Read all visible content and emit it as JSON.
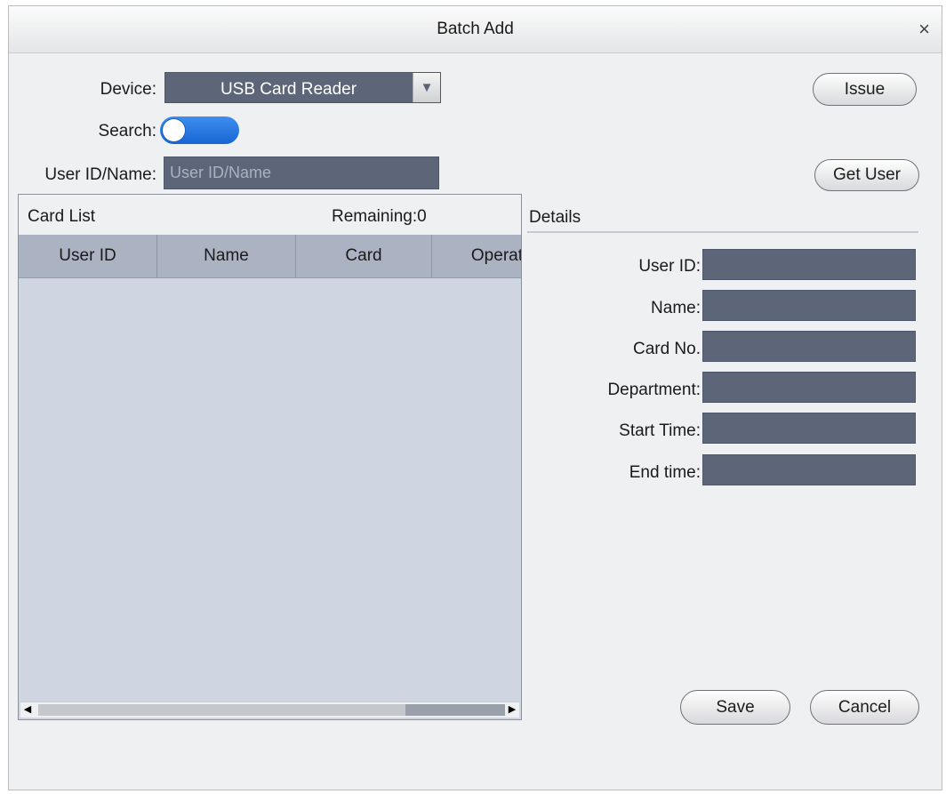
{
  "window": {
    "title": "Batch Add",
    "close_glyph": "×"
  },
  "device": {
    "label": "Device:",
    "value": "USB Card Reader"
  },
  "search": {
    "label": "Search:",
    "enabled": true
  },
  "user_filter": {
    "label": "User ID/Name:",
    "placeholder": "User ID/Name",
    "value": ""
  },
  "buttons": {
    "issue": "Issue",
    "get_user": "Get User",
    "save": "Save",
    "cancel": "Cancel"
  },
  "card_list": {
    "title": "Card List",
    "remaining": "Remaining:0",
    "columns": [
      "User ID",
      "Name",
      "Card",
      "Operat"
    ],
    "rows": []
  },
  "details": {
    "title": "Details",
    "fields": [
      {
        "label": "User ID:",
        "value": ""
      },
      {
        "label": "Name:",
        "value": ""
      },
      {
        "label": "Card No.",
        "value": ""
      },
      {
        "label": "Department:",
        "value": ""
      },
      {
        "label": "Start Time:",
        "value": ""
      },
      {
        "label": "End time:",
        "value": ""
      }
    ]
  },
  "icons": {
    "close": "close-icon",
    "dropdown": "triangle-down-icon",
    "scroll_left": "arrow-left-icon",
    "scroll_right": "arrow-right-icon"
  },
  "colors": {
    "field_dark": "#5c6678",
    "toggle_on": "#2a7ae4",
    "table_header": "#abb3c3",
    "table_body": "#d0d6e1"
  }
}
